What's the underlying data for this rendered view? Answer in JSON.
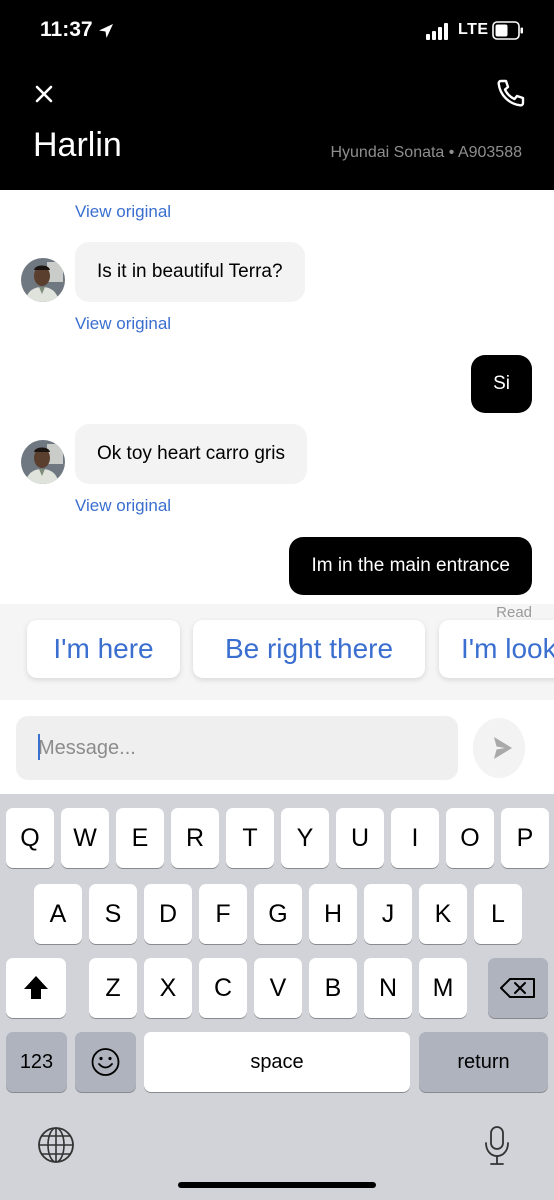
{
  "status_bar": {
    "time": "11:37",
    "network": "LTE"
  },
  "header": {
    "driver_name": "Harlin",
    "vehicle_info": "Hyundai Sonata • A903588"
  },
  "chat": {
    "view_original_label": "View original",
    "messages": [
      {
        "sender": "driver",
        "text": "Is it in beautiful Terra?"
      },
      {
        "sender": "me",
        "text": "Si"
      },
      {
        "sender": "driver",
        "text": "Ok toy heart carro gris"
      },
      {
        "sender": "me",
        "text": "Im in the main entrance"
      }
    ],
    "read_receipt": "Read"
  },
  "quick_replies": [
    "I'm here",
    "Be right there",
    "I'm looking"
  ],
  "composer": {
    "placeholder": "Message..."
  },
  "keyboard": {
    "row1": [
      "Q",
      "W",
      "E",
      "R",
      "T",
      "Y",
      "U",
      "I",
      "O",
      "P"
    ],
    "row2": [
      "A",
      "S",
      "D",
      "F",
      "G",
      "H",
      "J",
      "K",
      "L"
    ],
    "row3": [
      "Z",
      "X",
      "C",
      "V",
      "B",
      "N",
      "M"
    ],
    "numbers_label": "123",
    "space_label": "space",
    "return_label": "return"
  },
  "colors": {
    "accent": "#3a6fd0",
    "header_bg": "#000000",
    "bubble_in": "#f3f3f3",
    "bubble_out": "#000000",
    "keyboard_bg": "#d1d3d9"
  },
  "icons": [
    "close-icon",
    "phone-icon",
    "location-arrow-icon",
    "signal-icon",
    "battery-icon",
    "send-icon",
    "shift-icon",
    "backspace-icon",
    "emoji-icon",
    "globe-icon",
    "microphone-icon"
  ]
}
